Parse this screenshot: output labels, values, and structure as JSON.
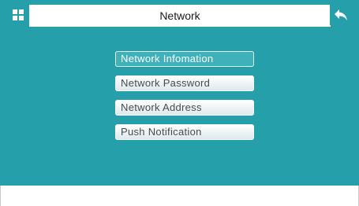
{
  "header": {
    "title": "Network",
    "home_icon": "grid-icon",
    "back_icon": "back-arrow-icon"
  },
  "menu": {
    "items": [
      {
        "label": "Network Infomation",
        "selected": true
      },
      {
        "label": "Network Password",
        "selected": false
      },
      {
        "label": "Network Address",
        "selected": false
      },
      {
        "label": "Push Notification",
        "selected": false
      }
    ]
  },
  "colors": {
    "accent": "#25a0ab",
    "selected_item": "#3fb1ba",
    "item_background": "#eef4f6"
  }
}
